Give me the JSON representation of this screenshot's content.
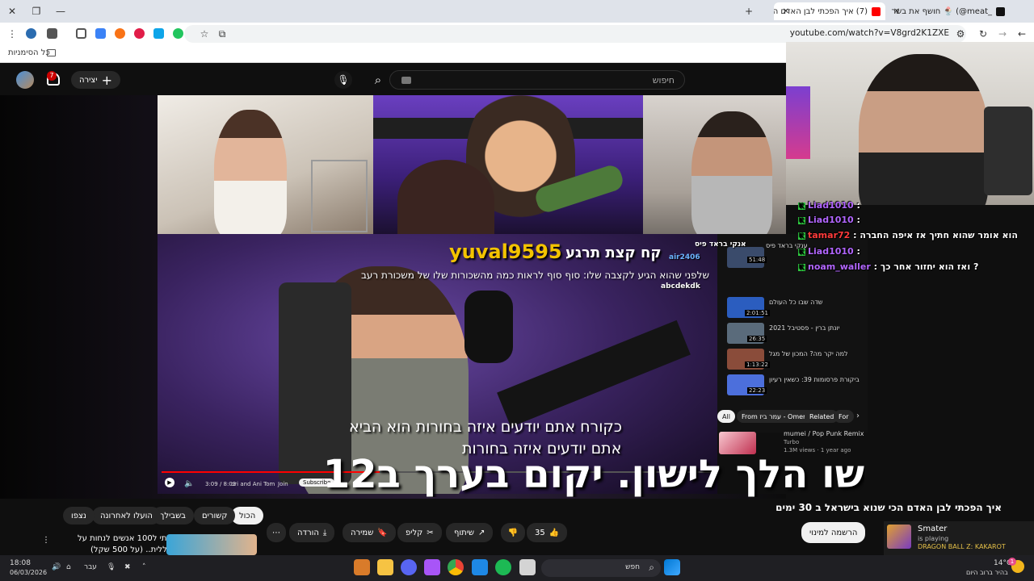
{
  "browser": {
    "tabs": [
      {
        "label": "(7) איך הפכתי לבן האדם הכי ש",
        "active": true
      },
      {
        "label": "_meat@) 🍨 חושף את בשר נא",
        "active": false
      }
    ],
    "url": "youtube.com/watch?v=V8grd2K1ZXE",
    "bookmarks_label": "כל הסימניות"
  },
  "youtube": {
    "search_placeholder": "חיפוש",
    "create_label": "יצירה",
    "notification_count": "7"
  },
  "overlay": {
    "username_big": "yuval9595",
    "subtitle_top": "קח קצת תרגע",
    "subtitle_mid": "שלפני שהוא הגיע לקצבה שלו: סוף סוף לראות כמה מהשכורות שלו של משכורת רעב",
    "caption_line1": "כקורח אתם יודעים איזה בחורות הוא הביא",
    "caption_line2": "אתם יודעים איזה בחורות",
    "big_bottom_text": "שו הלך לישון. יקום בערך ב12",
    "player_join": "Join",
    "player_subs": "Subscribe",
    "player_time": "3:09 / 8:03",
    "player_channel": "ori and Ani Tom"
  },
  "chat": [
    {
      "user": "Liad1010",
      "text": ":",
      "color": "#b266ff"
    },
    {
      "user": "Liad1010",
      "text": ":",
      "color": "#b266ff"
    },
    {
      "user": "tamar72",
      "text": ": הוא אומר שהוא חתיך אז איפה החברה",
      "color": "#ff3b3b"
    },
    {
      "user": "Liad1010",
      "text": ":",
      "color": "#b266ff"
    },
    {
      "user": "noam_waller",
      "text": ": ואז הוא יחזור אחר כך ?",
      "color": "#b266ff"
    }
  ],
  "inner_chat": {
    "lines": [
      "air2406",
      "abcdekdk"
    ],
    "right_text": "אנקי בראד פיס"
  },
  "sidebar_videos": [
    {
      "title": "ענקי בראד פיס",
      "duration": "51:48"
    },
    {
      "title": "שדה שבו כל העולם",
      "duration": "2:01:51"
    },
    {
      "title": "יונתן ברין - פסטיבל 2021",
      "duration": "26:35"
    },
    {
      "title": "למה יקר מה? המכון של מגל",
      "duration": "1:13:22"
    },
    {
      "title": "ביקורת פרסומות 39: כשאין רעיון",
      "duration": "22:23"
    }
  ],
  "sidebar_tabs": [
    "All",
    "From עמר ביז - Omerbig",
    "Related",
    "For"
  ],
  "sidebar_music": {
    "title": "mumei / Pop Punk Remix",
    "channel": "Turbo",
    "meta": "1.3M views · 1 year ago"
  },
  "video": {
    "title": "איך הפכתי לבן האדם הכי שנוא בישראל ב 30 ימים",
    "likes": "35",
    "actions": {
      "share": "שיתוף",
      "clip": "קליפ",
      "save": "שמירה",
      "download": "הורדה"
    },
    "subscribe_label": "הרשמה למינוי"
  },
  "filters": [
    "הכול",
    "קשורים",
    "בשבילך",
    "הועלו לאחרונה",
    "נצפו"
  ],
  "recommended": {
    "title": "גרמתי ל100 אנשים לנחות על",
    "subtitle": "החללית.. (על 500 שקל)"
  },
  "now_playing": {
    "name": "Smater",
    "status": "is playing",
    "game": "DRAGON BALL Z: KAKAROT"
  },
  "taskbar": {
    "time": "18:08",
    "date": "06/03/2026",
    "lang": "עבר",
    "search": "חפש",
    "weather_temp": "14°C",
    "weather_desc": "בהיר ברוב היום",
    "badge": "1"
  }
}
